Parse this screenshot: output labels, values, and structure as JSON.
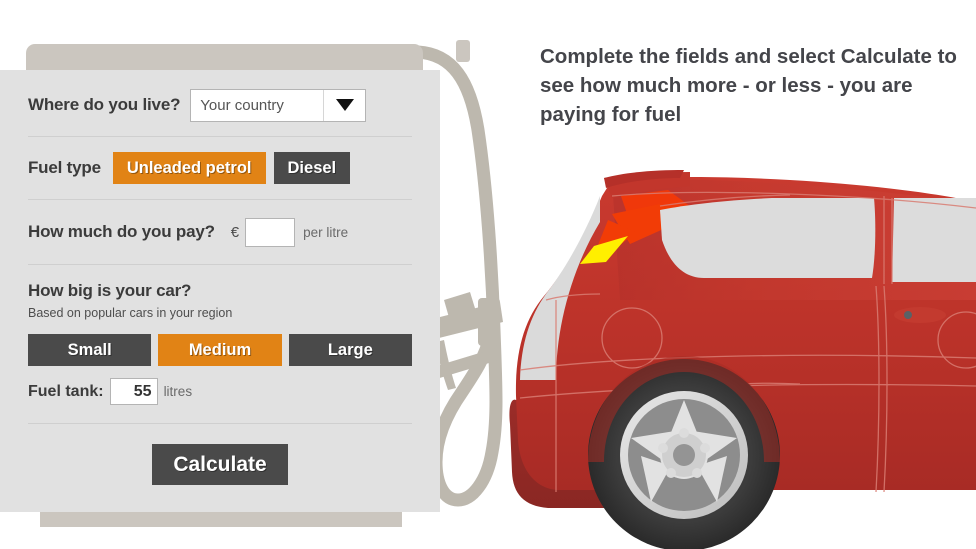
{
  "headline": "Complete the fields and select Calculate to see how much more - or less - you are paying for fuel",
  "form": {
    "country": {
      "label": "Where do you live?",
      "selected": "Your country",
      "caret_icon": "chevron-down-icon"
    },
    "fuel_type": {
      "label": "Fuel type",
      "options": [
        {
          "label": "Unleaded petrol",
          "selected": true
        },
        {
          "label": "Diesel",
          "selected": false
        }
      ]
    },
    "price": {
      "label": "How much do you pay?",
      "currency_symbol": "€",
      "value": "",
      "placeholder": "",
      "unit": "per litre"
    },
    "car_size": {
      "label": "How big is your car?",
      "sublabel": "Based on popular cars in your region",
      "options": [
        {
          "label": "Small",
          "selected": false
        },
        {
          "label": "Medium",
          "selected": true
        },
        {
          "label": "Large",
          "selected": false
        }
      ]
    },
    "fuel_tank": {
      "label": "Fuel tank:",
      "value": "55",
      "unit": "litres"
    },
    "submit": {
      "label": "Calculate"
    }
  },
  "illustration": {
    "pump": {
      "name": "fuel-pump",
      "body_color": "#cbc6bf",
      "hose_color": "#bdb8ae"
    },
    "car": {
      "name": "red-hatchback-car",
      "body_color": "#c0342c",
      "bumper_color": "#9e2f2b",
      "glass_color": "#dcdcdc",
      "taillight_red": "#f23b05",
      "taillight_yellow": "#ffef00",
      "wheel_color": "#d8d8d8",
      "tyre_color": "#3a3a3a"
    }
  },
  "colors": {
    "panel_bg": "#e1e1e1",
    "accent_orange": "#e18315",
    "button_dark": "#4a4a4a",
    "text_dark": "#3b3b3b",
    "headline_text": "#44454a"
  }
}
